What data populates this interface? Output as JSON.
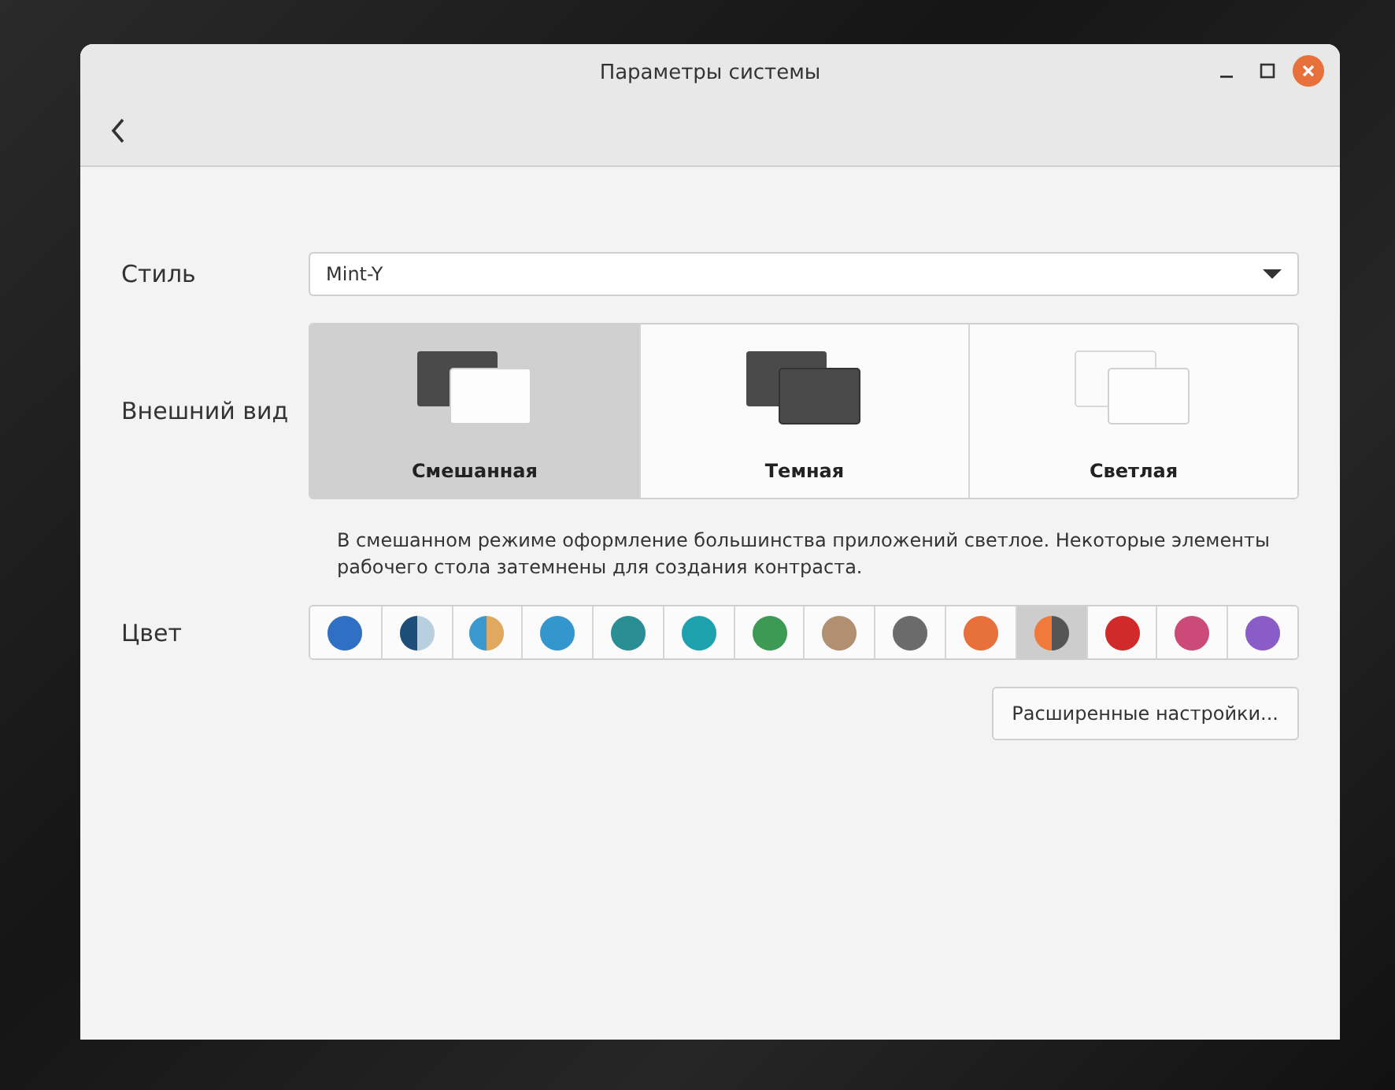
{
  "window": {
    "title": "Параметры системы"
  },
  "style": {
    "label": "Стиль",
    "value": "Mint-Y"
  },
  "appearance": {
    "label": "Внешний вид",
    "options": [
      {
        "label": "Смешанная",
        "kind": "mixed",
        "selected": true
      },
      {
        "label": "Темная",
        "kind": "dark",
        "selected": false
      },
      {
        "label": "Светлая",
        "kind": "light",
        "selected": false
      }
    ],
    "description": "В смешанном режиме оформление большинства приложений светлое. Некоторые элементы рабочего стола затемнены для создания контраста."
  },
  "colors": {
    "label": "Цвет",
    "swatches": [
      {
        "kind": "solid",
        "color": "#2f6fc4",
        "selected": false
      },
      {
        "kind": "split",
        "halves": [
          {
            "color": "#1f4d7a"
          },
          {
            "color": "#b8cfe0"
          }
        ],
        "selected": false
      },
      {
        "kind": "split",
        "halves": [
          {
            "color": "#3a9ad0"
          },
          {
            "color": "#e0a860"
          }
        ],
        "selected": false
      },
      {
        "kind": "solid",
        "color": "#3396cc",
        "selected": false
      },
      {
        "kind": "solid",
        "color": "#2a8e95",
        "selected": false
      },
      {
        "kind": "solid",
        "color": "#1fa0ad",
        "selected": false
      },
      {
        "kind": "solid",
        "color": "#3c9a55",
        "selected": false
      },
      {
        "kind": "solid",
        "color": "#b09070",
        "selected": false
      },
      {
        "kind": "solid",
        "color": "#6b6b6b",
        "selected": false
      },
      {
        "kind": "solid",
        "color": "#e8703a",
        "selected": false
      },
      {
        "kind": "split",
        "halves": [
          {
            "color": "#f07a3a"
          },
          {
            "color": "#555555"
          }
        ],
        "selected": true
      },
      {
        "kind": "solid",
        "color": "#d02a2a",
        "selected": false
      },
      {
        "kind": "solid",
        "color": "#cc4a78",
        "selected": false
      },
      {
        "kind": "solid",
        "color": "#8a5cc8",
        "selected": false
      }
    ]
  },
  "advanced_button": "Расширенные настройки..."
}
